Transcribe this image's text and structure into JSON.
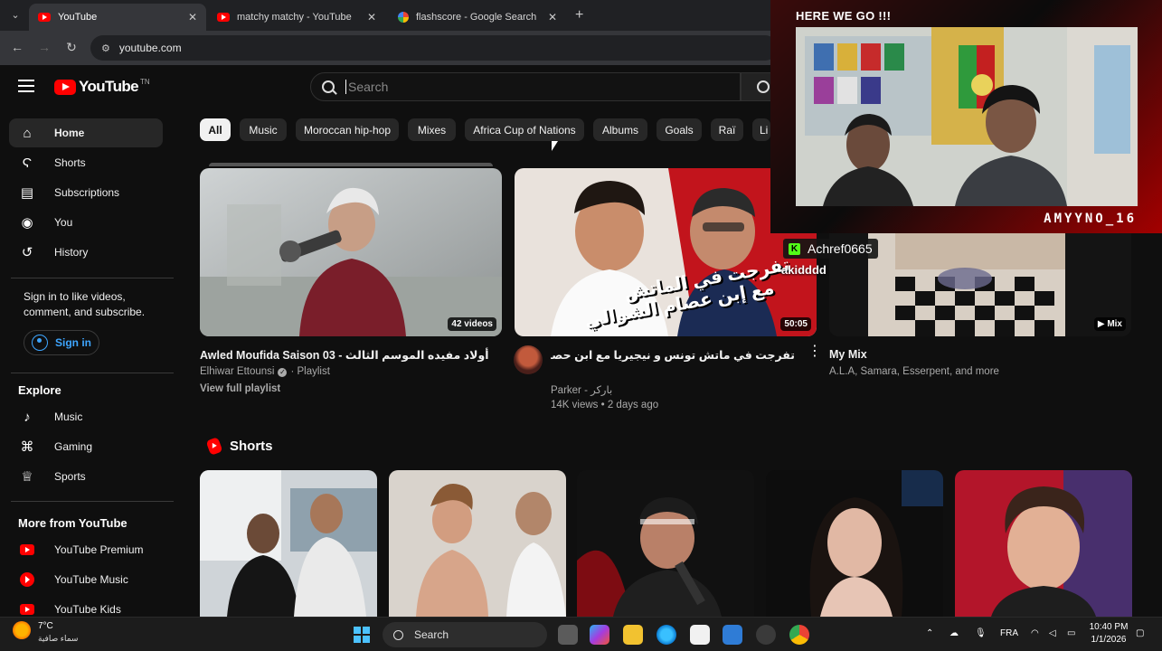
{
  "browser": {
    "tabs": [
      {
        "title": "YouTube",
        "favicon": "youtube-favicon",
        "active": true
      },
      {
        "title": "matchy matchy - YouTube",
        "favicon": "youtube-favicon",
        "active": false
      },
      {
        "title": "flashscore - Google Search",
        "favicon": "google-favicon",
        "active": false
      }
    ],
    "url": "youtube.com"
  },
  "header": {
    "logo_text": "YouTube",
    "country_code": "TN",
    "search_placeholder": "Search"
  },
  "sidebar": {
    "main_items": [
      {
        "label": "Home",
        "icon": "home-icon",
        "active": true
      },
      {
        "label": "Shorts",
        "icon": "shorts-icon"
      },
      {
        "label": "Subscriptions",
        "icon": "subscriptions-icon"
      },
      {
        "label": "You",
        "icon": "you-icon"
      },
      {
        "label": "History",
        "icon": "history-icon"
      }
    ],
    "signin_prompt": "Sign in to like videos, comment, and subscribe.",
    "signin_label": "Sign in",
    "explore_heading": "Explore",
    "explore_items": [
      {
        "label": "Music",
        "icon": "music-note-icon"
      },
      {
        "label": "Gaming",
        "icon": "gaming-icon"
      },
      {
        "label": "Sports",
        "icon": "trophy-icon"
      }
    ],
    "more_heading": "More from YouTube",
    "more_items": [
      {
        "label": "YouTube Premium",
        "icon": "youtube-premium-icon"
      },
      {
        "label": "YouTube Music",
        "icon": "youtube-music-icon"
      },
      {
        "label": "YouTube Kids",
        "icon": "youtube-kids-icon"
      }
    ]
  },
  "chips": [
    "All",
    "Music",
    "Moroccan hip-hop",
    "Mixes",
    "Africa Cup of Nations",
    "Albums",
    "Goals",
    "Raï",
    "Li"
  ],
  "videos": [
    {
      "title": "Awled Moufida Saison 03 - أولاد مفيده الموسم الثالث",
      "channel": "Elhiwar Ettounsi",
      "type": "Playlist",
      "badge": "42 videos",
      "link": "View full playlist"
    },
    {
      "title": "تفرجت في ماتش تونس و نيجيريا مع ابن حصام الشوالي 🎙 TN NG",
      "channel": "Parker - باركر",
      "views": "14K views",
      "age": "2 days ago",
      "badge": "50:05",
      "thumb_text_line1": "تفرجت في الماتش",
      "thumb_text_line2": "مع إبن عصام الشوالي"
    },
    {
      "title": "My Mix",
      "channel": "A.L.A, Samara, Esserpent, and more",
      "badge": "Mix"
    }
  ],
  "shorts": {
    "title": "Shorts",
    "count": 5
  },
  "stream_overlay": {
    "title": "HERE WE GO !!!",
    "username": "AMYYNO_16",
    "kick_user": "Achref0665",
    "chat_message": "akidddd"
  },
  "taskbar": {
    "temperature": "7°C",
    "weather_condition": "سماء صافية",
    "search_label": "Search",
    "language": "FRA",
    "time": "10:40 PM",
    "date": "1/1/2026"
  },
  "colors": {
    "youtube_red": "#ff0000",
    "link_blue": "#3ea6ff",
    "kick_green": "#53fc18",
    "background": "#0f0f0f"
  }
}
